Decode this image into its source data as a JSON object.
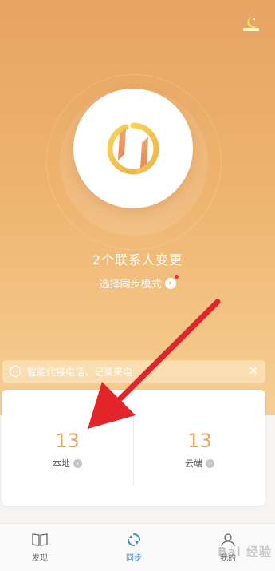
{
  "header": {
    "theme_icon": "night-mode-icon"
  },
  "sync": {
    "changes_text": "2个联系人变更",
    "mode_label": "选择同步模式",
    "mode_has_new_badge": true
  },
  "banner": {
    "text": "智能代接电话，记录来电",
    "close": "✕"
  },
  "stats": {
    "local": {
      "count": "13",
      "label": "本地"
    },
    "cloud": {
      "count": "13",
      "label": "云端"
    }
  },
  "tabs": [
    {
      "label": "发现",
      "icon": "book-icon"
    },
    {
      "label": "同步",
      "icon": "sync-icon",
      "active": true
    },
    {
      "label": "我的",
      "icon": "user-icon"
    }
  ],
  "watermark": "Bai 经验",
  "colors": {
    "header_gradient_top": "#e6a464",
    "header_gradient_bottom": "#f5cf96",
    "accent_orange": "#e8a263",
    "active_tab": "#3c8be0",
    "annotation_arrow": "#e3242b"
  }
}
